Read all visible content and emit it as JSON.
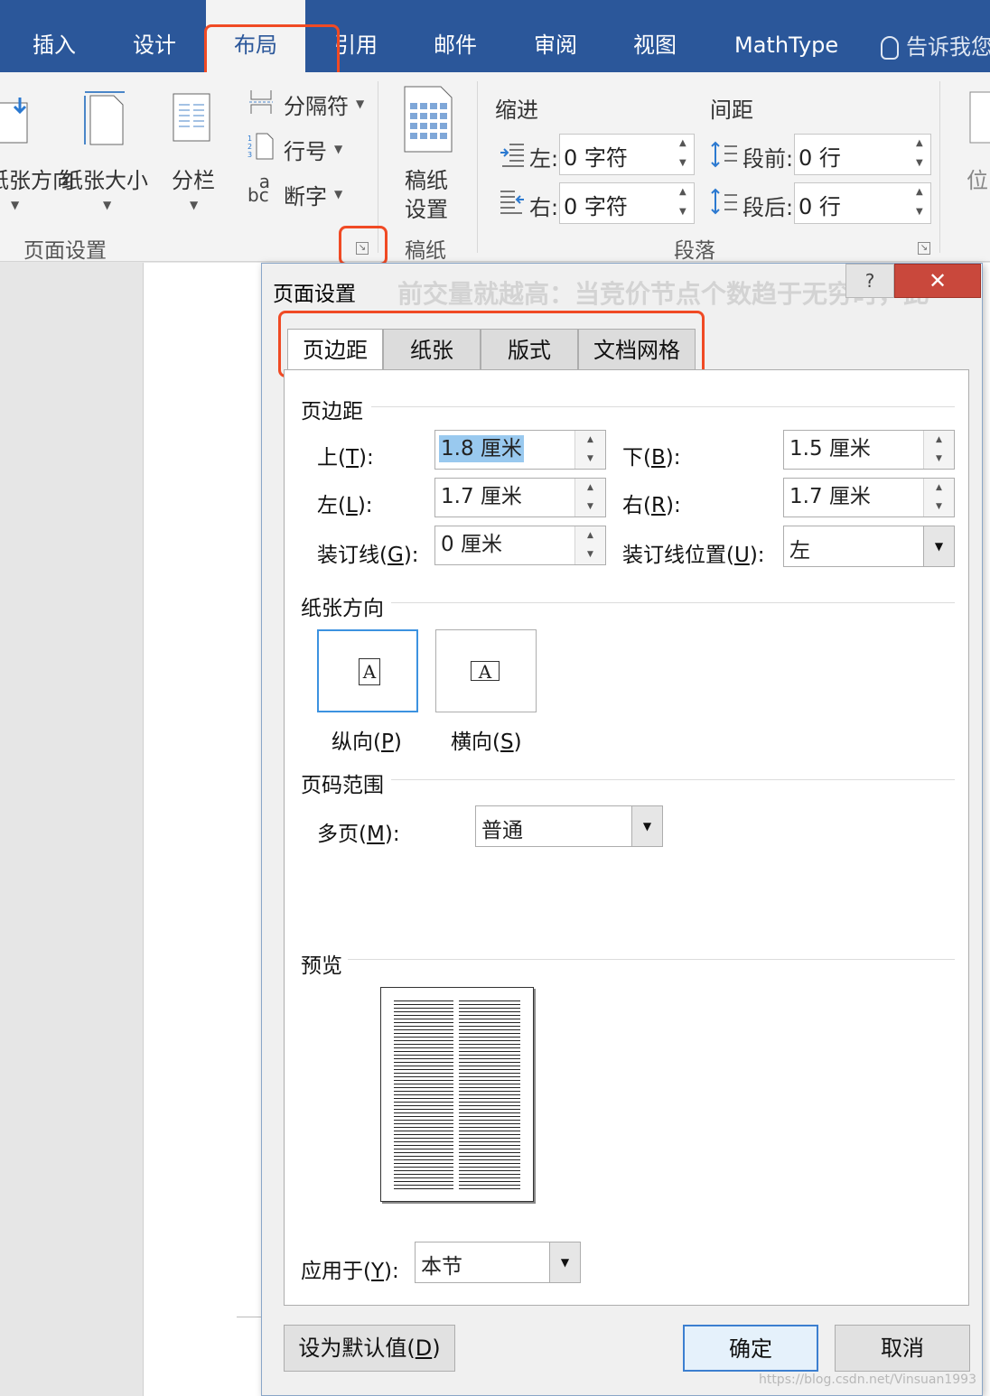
{
  "ribbon_tabs": [
    {
      "label": "插入"
    },
    {
      "label": "设计"
    },
    {
      "label": "布局"
    },
    {
      "label": "引用"
    },
    {
      "label": "邮件"
    },
    {
      "label": "审阅"
    },
    {
      "label": "视图"
    },
    {
      "label": "MathType"
    }
  ],
  "tell_me": "告诉我您",
  "ribbon": {
    "orientation_label": "纸张方向",
    "size_label": "纸张大小",
    "columns_label": "分栏",
    "breaks_label": "分隔符",
    "line_numbers_label": "行号",
    "hyphenation_label": "断字",
    "manuscript_setup_line1": "稿纸",
    "manuscript_setup_line2": "设置",
    "page_setup_group": "页面设置",
    "manuscript_group": "稿纸",
    "paragraph_group": "段落",
    "indent_title": "缩进",
    "spacing_title": "间距",
    "indent_left_label": "左:",
    "indent_left_value": "0 字符",
    "indent_right_label": "右:",
    "indent_right_value": "0 字符",
    "space_before_label": "段前:",
    "space_before_value": "0 行",
    "space_after_label": "段后:",
    "space_after_value": "0 行",
    "position_label": "位"
  },
  "dialog": {
    "title": "页面设置",
    "ghost_text": "前交量就越高：当竞价节点个数趋于无穷时，此",
    "help": "?",
    "close": "✕",
    "tabs": [
      "页边距",
      "纸张",
      "版式",
      "文档网格"
    ],
    "margins_section": "页边距",
    "top_label": "上(",
    "top_key": "T",
    "top_value": "1.8 厘米",
    "bottom_label": "下(",
    "bottom_key": "B",
    "bottom_value": "1.5 厘米",
    "left_label": "左(",
    "left_key": "L",
    "left_value": "1.7 厘米",
    "right_label": "右(",
    "right_key": "R",
    "right_value": "1.7 厘米",
    "gutter_label": "装订线(",
    "gutter_key": "G",
    "gutter_value": "0 厘米",
    "gutter_pos_label": "装订线位置(",
    "gutter_pos_key": "U",
    "gutter_pos_value": "左",
    "close_paren": "):",
    "orientation_section": "纸张方向",
    "portrait_label": "纵向(",
    "portrait_key": "P",
    "landscape_label": "横向(",
    "landscape_key": "S",
    "paren_close": ")",
    "pages_section": "页码范围",
    "multiple_pages_label": "多页(",
    "multiple_pages_key": "M",
    "multiple_pages_value": "普通",
    "preview_section": "预览",
    "apply_label": "应用于(",
    "apply_key": "Y",
    "apply_value": "本节",
    "default_button": "设为默认值(",
    "default_key": "D",
    "ok_button": "确定",
    "cancel_button": "取消",
    "watermark": "https://blog.csdn.net/Vinsuan1993"
  },
  "colors": {
    "ribbon_blue": "#2b579a",
    "highlight": "#f04a24",
    "selection": "#99c9ef"
  }
}
